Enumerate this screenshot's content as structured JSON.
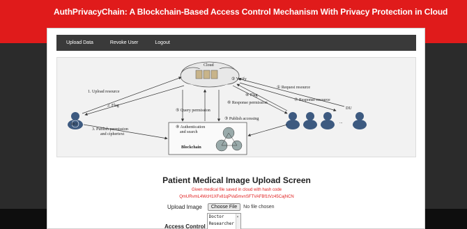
{
  "site": {
    "title": "AuthPrivacyChain: A Blockchain-Based Access Control Mechanism With Privacy Protection in Cloud"
  },
  "nav": {
    "items": [
      "Upload Data",
      "Revoke User",
      "Logout"
    ]
  },
  "diagram": {
    "cloud_label": "Cloud",
    "verify": "② Verify",
    "upload_resource": "1. Upload resource",
    "flag_left": "2. Flag",
    "publish_permission": "3. Publish permission",
    "publish_permission_2": "and ciphertext",
    "flag_right": "④ Flag",
    "request_resource": "① Request resource",
    "response_resource": "⑦ Response resource",
    "response_permission": "⑥ Response permission",
    "query_permission": "⑤ Query permission",
    "publish_accessing": "③ Publish accessing",
    "auth_search": "⑧ Authentication",
    "auth_search_2": "and search",
    "blockchain": "Blockchain",
    "do_label": "DO",
    "du_label": "DU",
    "ellipsis": "..."
  },
  "upload": {
    "heading": "Patient Medical Image Upload Screen",
    "message": "Given medical file saved in cloud with hash code",
    "hash": "QmURvmL4WcH1XFv81qPVa5mvnSFTVAFBf1tVz45CajNCN",
    "image_label": "Upload Image",
    "choose_button": "Choose File",
    "no_file": "No file chosen",
    "access_label": "Access Control",
    "roles": [
      "Doctor",
      "Researcher"
    ]
  },
  "colors": {
    "header_red": "#e01b1b",
    "dark_band": "#2b2b2b",
    "navbar": "#3a3a3a"
  }
}
